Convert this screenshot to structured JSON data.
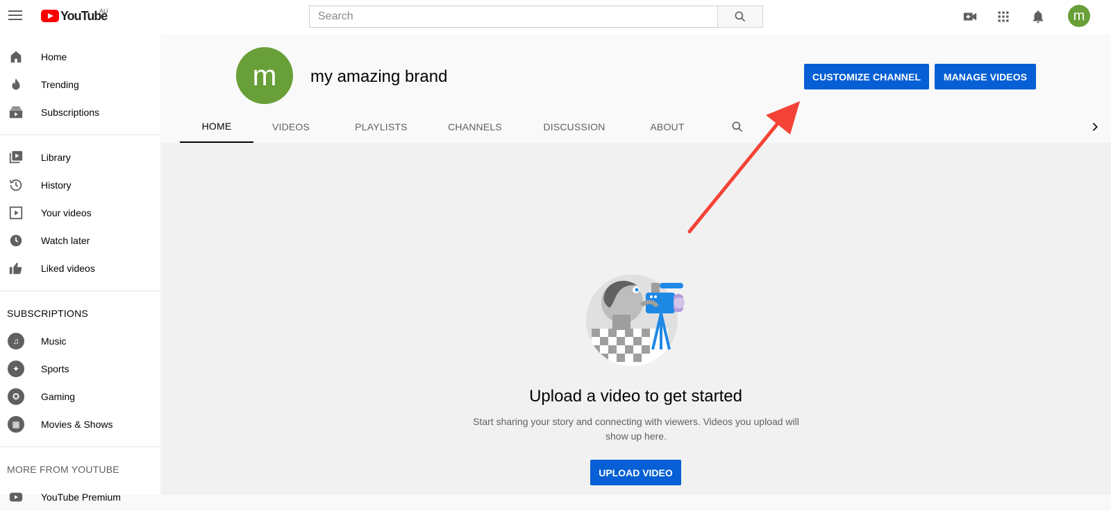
{
  "topbar": {
    "logo_text": "YouTube",
    "country_code": "AU",
    "search_placeholder": "Search",
    "avatar_letter": "m"
  },
  "sidebar": {
    "main_items": [
      {
        "label": "Home",
        "icon": "home-icon"
      },
      {
        "label": "Trending",
        "icon": "flame-icon"
      },
      {
        "label": "Subscriptions",
        "icon": "subscriptions-icon"
      }
    ],
    "library_items": [
      {
        "label": "Library",
        "icon": "library-icon"
      },
      {
        "label": "History",
        "icon": "history-icon"
      },
      {
        "label": "Your videos",
        "icon": "your-videos-icon"
      },
      {
        "label": "Watch later",
        "icon": "clock-icon"
      },
      {
        "label": "Liked videos",
        "icon": "thumbs-up-icon"
      }
    ],
    "subscriptions_title": "SUBSCRIPTIONS",
    "subscriptions": [
      {
        "label": "Music",
        "icon": "music-icon"
      },
      {
        "label": "Sports",
        "icon": "sports-icon"
      },
      {
        "label": "Gaming",
        "icon": "gaming-icon"
      },
      {
        "label": "Movies & Shows",
        "icon": "movies-icon"
      }
    ],
    "more_title": "MORE FROM YOUTUBE",
    "more_items": [
      {
        "label": "YouTube Premium",
        "icon": "youtube-premium-icon"
      }
    ]
  },
  "channel": {
    "avatar_letter": "m",
    "name": "my amazing brand",
    "customize_label": "CUSTOMIZE CHANNEL",
    "manage_label": "MANAGE VIDEOS",
    "tabs": [
      {
        "label": "HOME",
        "active": true
      },
      {
        "label": "VIDEOS"
      },
      {
        "label": "PLAYLISTS"
      },
      {
        "label": "CHANNELS"
      },
      {
        "label": "DISCUSSION"
      },
      {
        "label": "ABOUT"
      }
    ]
  },
  "main": {
    "title": "Upload a video to get started",
    "description": "Start sharing your story and connecting with viewers. Videos you upload will show up here.",
    "upload_label": "UPLOAD VIDEO"
  },
  "colors": {
    "brand_red": "#ff0000",
    "button_blue": "#065fd4",
    "avatar_green": "#689f38",
    "annotation_arrow": "#f44336"
  }
}
